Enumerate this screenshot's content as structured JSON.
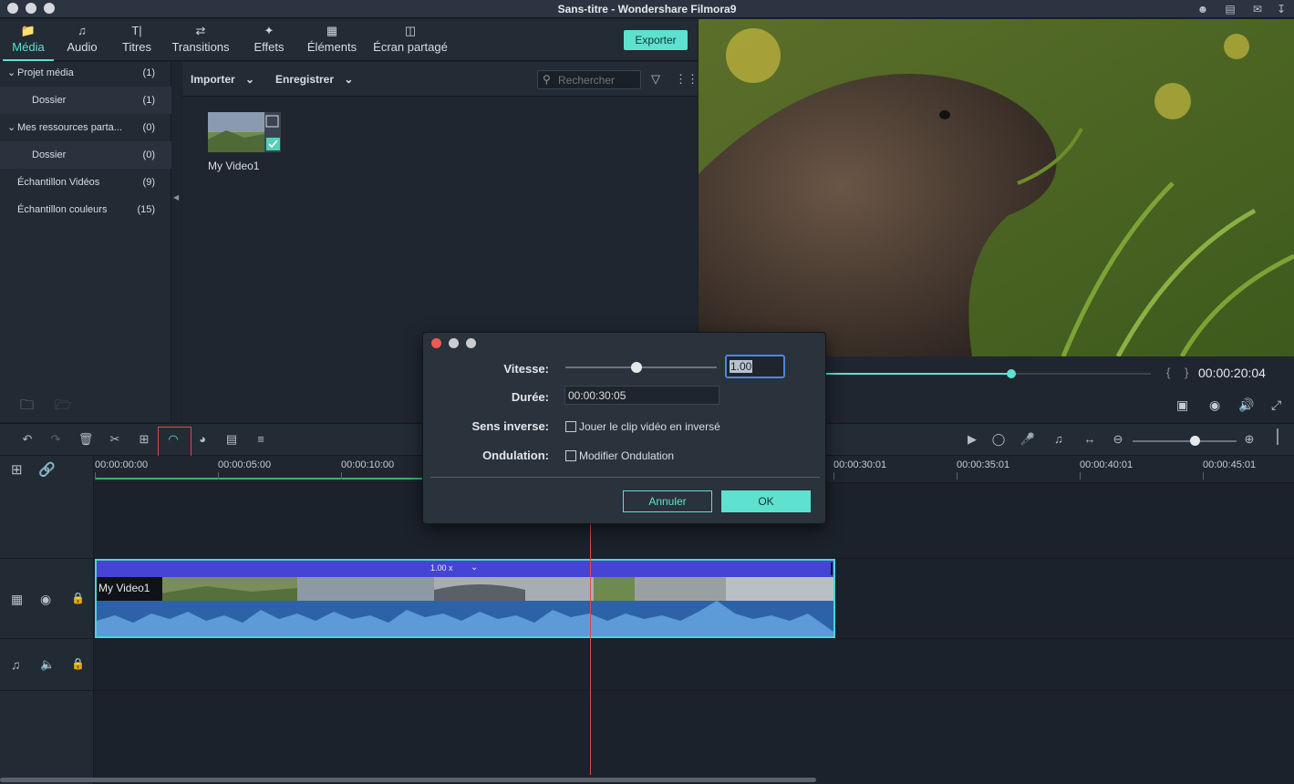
{
  "window": {
    "title": "Sans-titre - Wondershare Filmora9"
  },
  "tabs": [
    {
      "label": "Média",
      "icon": "folder-icon",
      "active": true
    },
    {
      "label": "Audio",
      "icon": "music-note-icon"
    },
    {
      "label": "Titres",
      "icon": "title-text-icon"
    },
    {
      "label": "Transitions",
      "icon": "transition-icon"
    },
    {
      "label": "Effets",
      "icon": "effects-icon"
    },
    {
      "label": "Éléments",
      "icon": "image-icon"
    },
    {
      "label": "Écran partagé",
      "icon": "split-screen-icon"
    }
  ],
  "toolbar": {
    "export_label": "Exporter"
  },
  "sidebar": {
    "items": [
      {
        "label": "Projet média",
        "count": "(1)",
        "expanded": true
      },
      {
        "label": "Dossier",
        "count": "(1)"
      },
      {
        "label": "Mes ressources parta...",
        "count": "(0)",
        "expanded": true
      },
      {
        "label": "Dossier",
        "count": "(0)"
      },
      {
        "label": "Échantillon Vidéos",
        "count": "(9)"
      },
      {
        "label": "Échantillon couleurs",
        "count": "(15)"
      }
    ]
  },
  "media": {
    "import_label": "Importer",
    "record_label": "Enregistrer",
    "search_placeholder": "Rechercher",
    "items": [
      {
        "name": "My Video1"
      }
    ]
  },
  "preview": {
    "timecode": "00:00:20:04",
    "progress": 0.57
  },
  "timeline": {
    "ruler": [
      "00:00:00:00",
      "00:00:05:00",
      "00:00:10:00",
      "00:00:30:01",
      "00:00:35:01",
      "00:00:40:01",
      "00:00:45:01"
    ],
    "clip": {
      "name": "My Video1",
      "speed_label": "1.00 x"
    },
    "zoom": 0.6
  },
  "dialog": {
    "speed_label": "Vitesse:",
    "speed_value": "1.00",
    "duration_label": "Durée:",
    "duration_value": "00:00:30:05",
    "reverse_label": "Sens inverse:",
    "reverse_option": "Jouer le clip vidéo en inversé",
    "ripple_label": "Ondulation:",
    "ripple_option": "Modifier Ondulation",
    "cancel_label": "Annuler",
    "ok_label": "OK",
    "speed_slider": 0.47
  },
  "colors": {
    "accent": "#5ee1cf",
    "clip_header": "#4545d4",
    "playhead": "#e0474c"
  }
}
